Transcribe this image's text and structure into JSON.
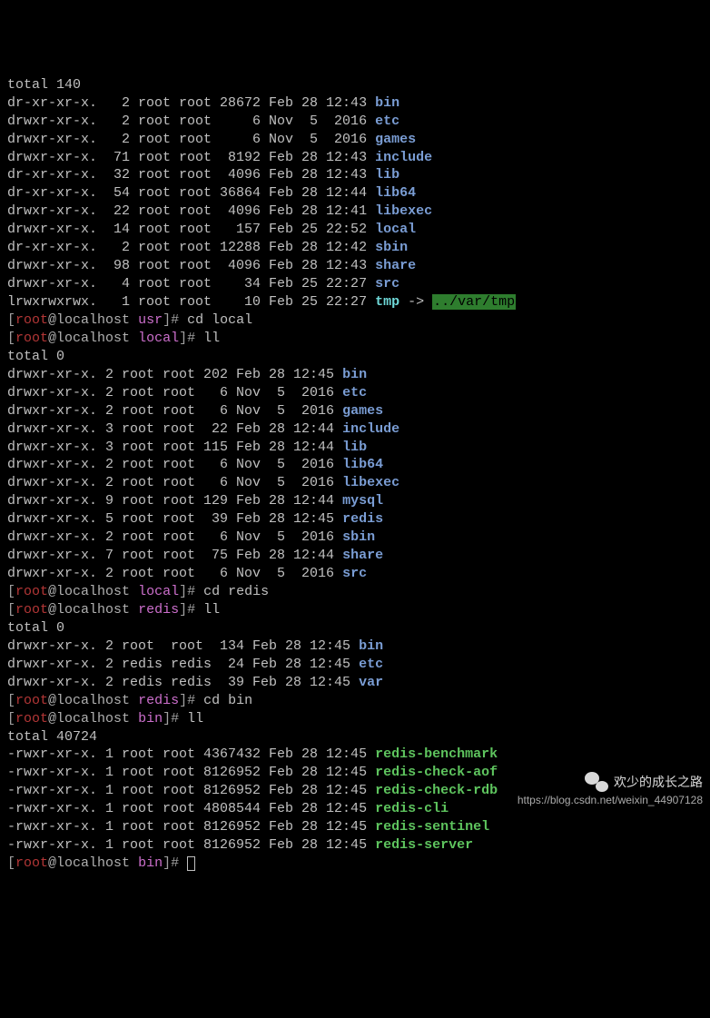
{
  "totals": {
    "usr": "total 140",
    "local": "total 0",
    "redis": "total 0",
    "bin": "total 40724"
  },
  "usr_listing": [
    {
      "perm": "dr-xr-xr-x.",
      "links": "  2",
      "owner": "root",
      "group": "root",
      "size": "28672",
      "date": "Feb 28 12:43",
      "name": "bin",
      "type": "dir"
    },
    {
      "perm": "drwxr-xr-x.",
      "links": "  2",
      "owner": "root",
      "group": "root",
      "size": "    6",
      "date": "Nov  5  2016",
      "name": "etc",
      "type": "dir"
    },
    {
      "perm": "drwxr-xr-x.",
      "links": "  2",
      "owner": "root",
      "group": "root",
      "size": "    6",
      "date": "Nov  5  2016",
      "name": "games",
      "type": "dir"
    },
    {
      "perm": "drwxr-xr-x.",
      "links": " 71",
      "owner": "root",
      "group": "root",
      "size": " 8192",
      "date": "Feb 28 12:43",
      "name": "include",
      "type": "dir"
    },
    {
      "perm": "dr-xr-xr-x.",
      "links": " 32",
      "owner": "root",
      "group": "root",
      "size": " 4096",
      "date": "Feb 28 12:43",
      "name": "lib",
      "type": "dir"
    },
    {
      "perm": "dr-xr-xr-x.",
      "links": " 54",
      "owner": "root",
      "group": "root",
      "size": "36864",
      "date": "Feb 28 12:44",
      "name": "lib64",
      "type": "dir"
    },
    {
      "perm": "drwxr-xr-x.",
      "links": " 22",
      "owner": "root",
      "group": "root",
      "size": " 4096",
      "date": "Feb 28 12:41",
      "name": "libexec",
      "type": "dir"
    },
    {
      "perm": "drwxr-xr-x.",
      "links": " 14",
      "owner": "root",
      "group": "root",
      "size": "  157",
      "date": "Feb 25 22:52",
      "name": "local",
      "type": "dir"
    },
    {
      "perm": "dr-xr-xr-x.",
      "links": "  2",
      "owner": "root",
      "group": "root",
      "size": "12288",
      "date": "Feb 28 12:42",
      "name": "sbin",
      "type": "dir"
    },
    {
      "perm": "drwxr-xr-x.",
      "links": " 98",
      "owner": "root",
      "group": "root",
      "size": " 4096",
      "date": "Feb 28 12:43",
      "name": "share",
      "type": "dir"
    },
    {
      "perm": "drwxr-xr-x.",
      "links": "  4",
      "owner": "root",
      "group": "root",
      "size": "   34",
      "date": "Feb 25 22:27",
      "name": "src",
      "type": "dir"
    },
    {
      "perm": "lrwxrwxrwx.",
      "links": "  1",
      "owner": "root",
      "group": "root",
      "size": "   10",
      "date": "Feb 25 22:27",
      "name": "tmp",
      "type": "sym",
      "target": "../var/tmp"
    }
  ],
  "local_listing": [
    {
      "perm": "drwxr-xr-x.",
      "links": "2",
      "owner": "root",
      "group": "root",
      "size": "202",
      "date": "Feb 28 12:45",
      "name": "bin",
      "type": "dir"
    },
    {
      "perm": "drwxr-xr-x.",
      "links": "2",
      "owner": "root",
      "group": "root",
      "size": "  6",
      "date": "Nov  5  2016",
      "name": "etc",
      "type": "dir"
    },
    {
      "perm": "drwxr-xr-x.",
      "links": "2",
      "owner": "root",
      "group": "root",
      "size": "  6",
      "date": "Nov  5  2016",
      "name": "games",
      "type": "dir"
    },
    {
      "perm": "drwxr-xr-x.",
      "links": "3",
      "owner": "root",
      "group": "root",
      "size": " 22",
      "date": "Feb 28 12:44",
      "name": "include",
      "type": "dir"
    },
    {
      "perm": "drwxr-xr-x.",
      "links": "3",
      "owner": "root",
      "group": "root",
      "size": "115",
      "date": "Feb 28 12:44",
      "name": "lib",
      "type": "dir"
    },
    {
      "perm": "drwxr-xr-x.",
      "links": "2",
      "owner": "root",
      "group": "root",
      "size": "  6",
      "date": "Nov  5  2016",
      "name": "lib64",
      "type": "dir"
    },
    {
      "perm": "drwxr-xr-x.",
      "links": "2",
      "owner": "root",
      "group": "root",
      "size": "  6",
      "date": "Nov  5  2016",
      "name": "libexec",
      "type": "dir"
    },
    {
      "perm": "drwxr-xr-x.",
      "links": "9",
      "owner": "root",
      "group": "root",
      "size": "129",
      "date": "Feb 28 12:44",
      "name": "mysql",
      "type": "dir"
    },
    {
      "perm": "drwxr-xr-x.",
      "links": "5",
      "owner": "root",
      "group": "root",
      "size": " 39",
      "date": "Feb 28 12:45",
      "name": "redis",
      "type": "dir"
    },
    {
      "perm": "drwxr-xr-x.",
      "links": "2",
      "owner": "root",
      "group": "root",
      "size": "  6",
      "date": "Nov  5  2016",
      "name": "sbin",
      "type": "dir"
    },
    {
      "perm": "drwxr-xr-x.",
      "links": "7",
      "owner": "root",
      "group": "root",
      "size": " 75",
      "date": "Feb 28 12:44",
      "name": "share",
      "type": "dir"
    },
    {
      "perm": "drwxr-xr-x.",
      "links": "2",
      "owner": "root",
      "group": "root",
      "size": "  6",
      "date": "Nov  5  2016",
      "name": "src",
      "type": "dir"
    }
  ],
  "redis_listing": [
    {
      "perm": "drwxr-xr-x.",
      "links": "2",
      "owner": "root ",
      "group": "root ",
      "size": "134",
      "date": "Feb 28 12:45",
      "name": "bin",
      "type": "dir"
    },
    {
      "perm": "drwxr-xr-x.",
      "links": "2",
      "owner": "redis",
      "group": "redis",
      "size": " 24",
      "date": "Feb 28 12:45",
      "name": "etc",
      "type": "dir"
    },
    {
      "perm": "drwxr-xr-x.",
      "links": "2",
      "owner": "redis",
      "group": "redis",
      "size": " 39",
      "date": "Feb 28 12:45",
      "name": "var",
      "type": "dir"
    }
  ],
  "bin_listing": [
    {
      "perm": "-rwxr-xr-x.",
      "links": "1",
      "owner": "root",
      "group": "root",
      "size": "4367432",
      "date": "Feb 28 12:45",
      "name": "redis-benchmark",
      "type": "exec"
    },
    {
      "perm": "-rwxr-xr-x.",
      "links": "1",
      "owner": "root",
      "group": "root",
      "size": "8126952",
      "date": "Feb 28 12:45",
      "name": "redis-check-aof",
      "type": "exec"
    },
    {
      "perm": "-rwxr-xr-x.",
      "links": "1",
      "owner": "root",
      "group": "root",
      "size": "8126952",
      "date": "Feb 28 12:45",
      "name": "redis-check-rdb",
      "type": "exec"
    },
    {
      "perm": "-rwxr-xr-x.",
      "links": "1",
      "owner": "root",
      "group": "root",
      "size": "4808544",
      "date": "Feb 28 12:45",
      "name": "redis-cli",
      "type": "exec"
    },
    {
      "perm": "-rwxr-xr-x.",
      "links": "1",
      "owner": "root",
      "group": "root",
      "size": "8126952",
      "date": "Feb 28 12:45",
      "name": "redis-sentinel",
      "type": "exec"
    },
    {
      "perm": "-rwxr-xr-x.",
      "links": "1",
      "owner": "root",
      "group": "root",
      "size": "8126952",
      "date": "Feb 28 12:45",
      "name": "redis-server",
      "type": "exec"
    }
  ],
  "prompts": {
    "user": "root",
    "host": "@localhost",
    "usr_path": "usr",
    "local_path": "local",
    "redis_path": "redis",
    "bin_path": "bin",
    "cmd_cd_local": "cd local",
    "cmd_ll": "ll",
    "cmd_cd_redis": "cd redis",
    "cmd_cd_bin": "cd bin",
    "arrow": " -> "
  },
  "watermark": {
    "text": "欢少的成长之路",
    "url": "https://blog.csdn.net/weixin_44907128"
  }
}
